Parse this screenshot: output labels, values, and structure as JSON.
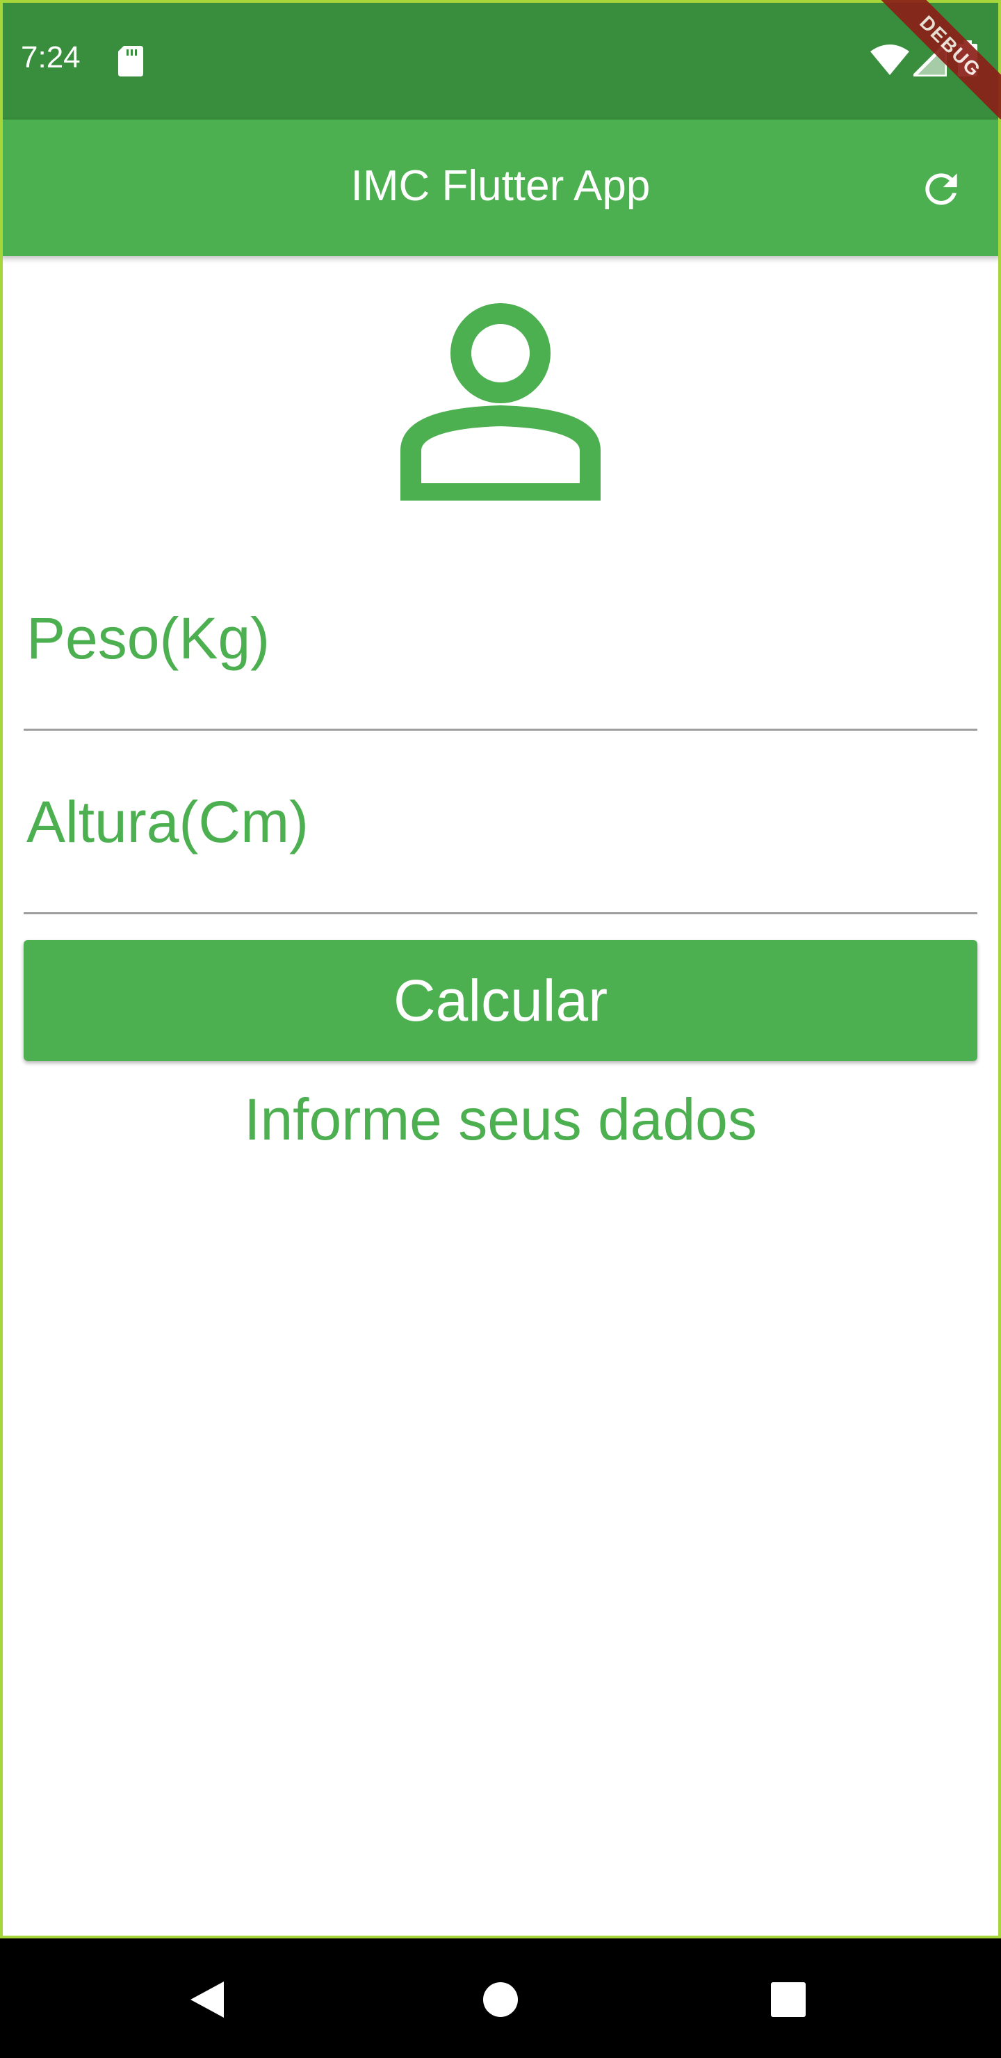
{
  "status_bar": {
    "time": "7:24",
    "icons": [
      "sd-card-icon",
      "wifi-icon",
      "signal-icon",
      "battery-icon"
    ],
    "background_color": "#388e3c"
  },
  "debug_banner": {
    "label": "DEBUG",
    "color": "#8a2018"
  },
  "app_bar": {
    "title": "IMC Flutter App",
    "action_icon": "refresh-icon",
    "background_color": "#4caf50"
  },
  "main": {
    "avatar_icon": "person-outline-icon",
    "weight_field": {
      "label": "Peso(Kg)",
      "value": ""
    },
    "height_field": {
      "label": "Altura(Cm)",
      "value": ""
    },
    "calculate_button": {
      "label": "Calcular"
    },
    "info_text": "Informe seus dados",
    "accent_color": "#4caf50"
  },
  "nav_bar": {
    "buttons": [
      "back-icon",
      "home-icon",
      "recents-icon"
    ]
  }
}
